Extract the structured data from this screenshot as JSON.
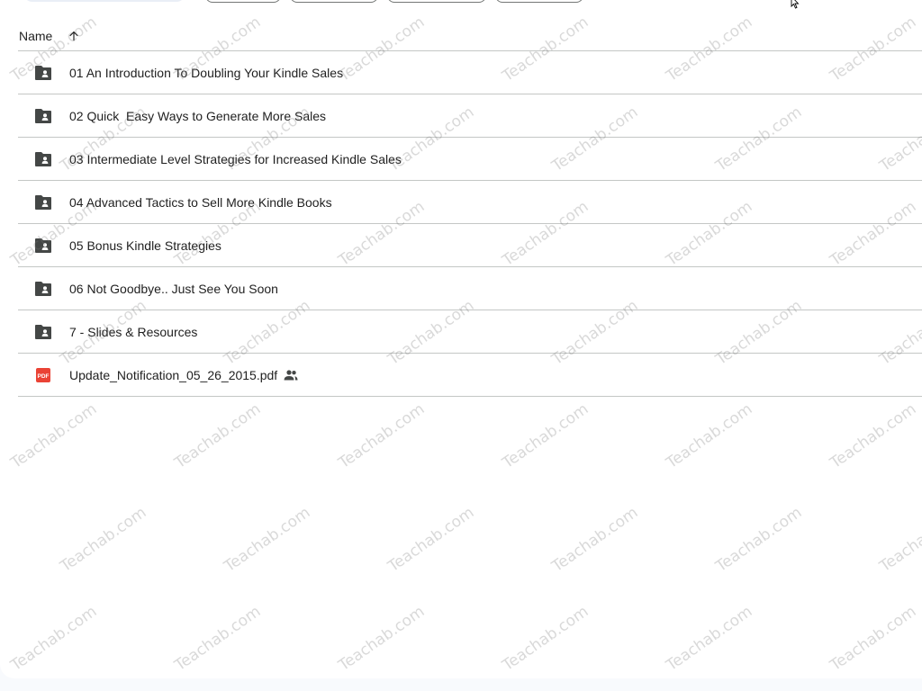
{
  "header": {
    "name_label": "Name"
  },
  "files": [
    {
      "name": "01 An Introduction To Doubling Your Kindle Sales",
      "type": "shared-folder",
      "shared": false
    },
    {
      "name": "02 Quick  Easy Ways to Generate More Sales",
      "type": "shared-folder",
      "shared": false
    },
    {
      "name": "03 Intermediate Level Strategies for Increased Kindle Sales",
      "type": "shared-folder",
      "shared": false
    },
    {
      "name": "04 Advanced Tactics to Sell More Kindle Books",
      "type": "shared-folder",
      "shared": false
    },
    {
      "name": "05 Bonus Kindle Strategies",
      "type": "shared-folder",
      "shared": false
    },
    {
      "name": "06 Not Goodbye.. Just See You Soon",
      "type": "shared-folder",
      "shared": false
    },
    {
      "name": "7 - Slides & Resources",
      "type": "shared-folder",
      "shared": false
    },
    {
      "name": "Update_Notification_05_26_2015.pdf",
      "type": "pdf",
      "shared": true
    }
  ],
  "icons": {
    "folder": "shared-folder-icon",
    "pdf": "pdf-icon",
    "shared": "people-icon",
    "sort": "arrow-up-icon"
  },
  "pdf_badge": "PDF",
  "watermark_text": "Teachab.com",
  "colors": {
    "folder": "#444746",
    "pdf": "#ea4335",
    "divider": "#c4c7c5",
    "text": "#1f1f1f"
  }
}
